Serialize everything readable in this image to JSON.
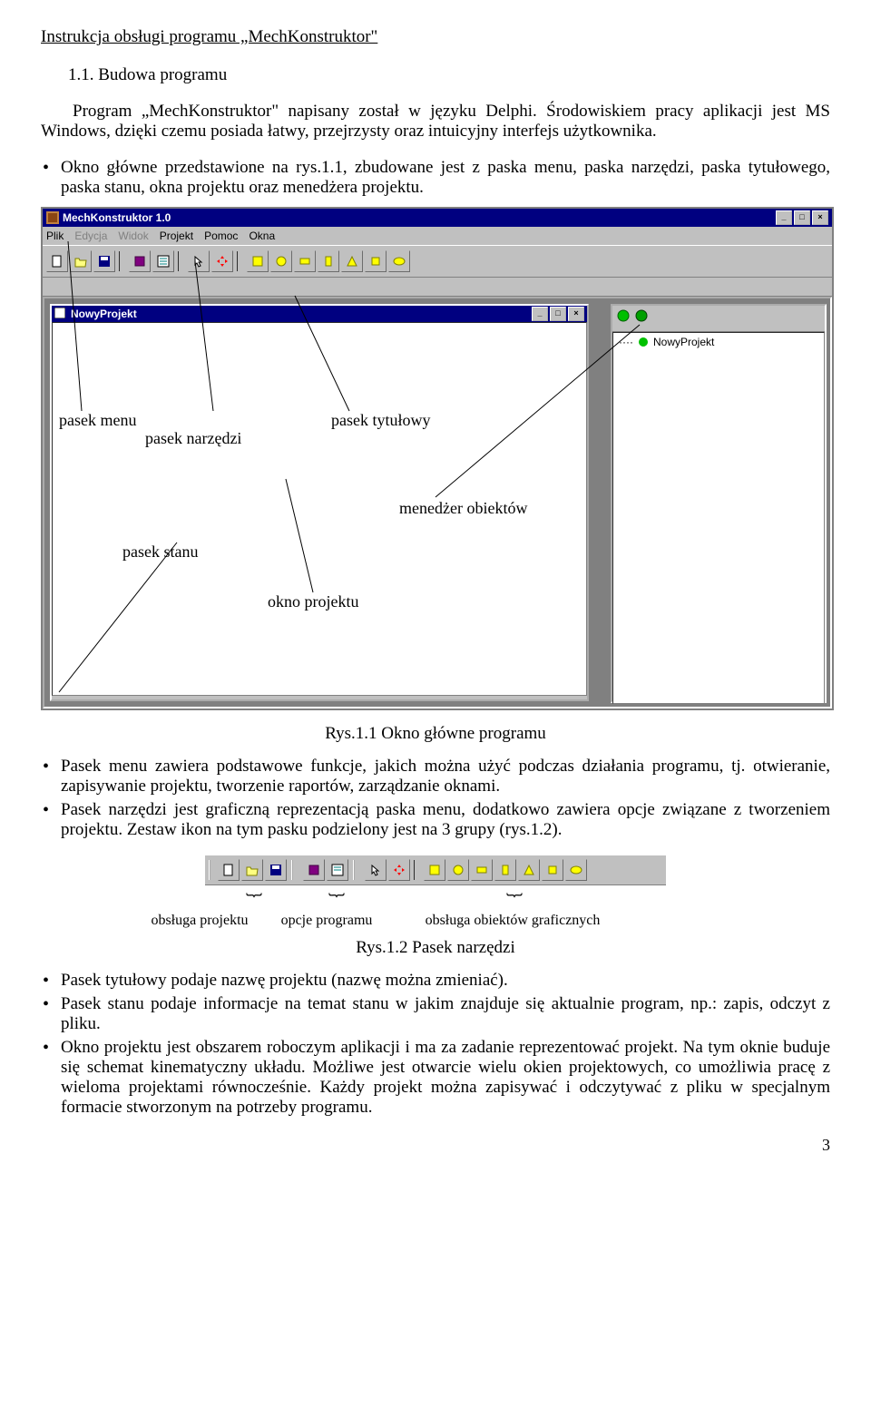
{
  "header": "Instrukcja obsługi programu „MechKonstruktor\"",
  "section": "1.1. Budowa programu",
  "intro_para": "Program „MechKonstruktor\" napisany został w języku Delphi. Środowiskiem pracy aplikacji jest MS Windows, dzięki czemu posiada łatwy, przejrzysty oraz intuicyjny interfejs użytkownika.",
  "bullet1": "Okno główne przedstawione na rys.1.1, zbudowane jest z paska menu, paska narzędzi, paska tytułowego, paska stanu, okna projektu oraz menedżera projektu.",
  "win": {
    "title": "MechKonstruktor 1.0",
    "menus": [
      "Plik",
      "Edycja",
      "Widok",
      "Projekt",
      "Pomoc",
      "Okna"
    ],
    "sub_title": "NowyProjekt",
    "tree_item": "NowyProjekt"
  },
  "anno": {
    "pasek_menu": "pasek menu",
    "pasek_narzedzi": "pasek narzędzi",
    "pasek_tytulowy": "pasek tytułowy",
    "menedzer": "menedżer obiektów",
    "pasek_stanu": "pasek stanu",
    "okno_projektu": "okno projektu"
  },
  "caption1": "Rys.1.1 Okno główne programu",
  "bullets2": [
    "Pasek menu zawiera podstawowe funkcje, jakich można użyć podczas działania programu, tj. otwieranie, zapisywanie projektu, tworzenie raportów, zarządzanie oknami.",
    "Pasek narzędzi jest graficzną reprezentacją paska menu, dodatkowo zawiera opcje związane z tworzeniem projektu. Zestaw ikon na tym pasku podzielony jest na 3 grupy (rys.1.2)."
  ],
  "brace_labels": {
    "a": "obsługa projektu",
    "b": "opcje programu",
    "c": "obsługa obiektów graficznych"
  },
  "caption2": "Rys.1.2 Pasek narzędzi",
  "bullets3": [
    "Pasek tytułowy podaje nazwę projektu (nazwę można zmieniać).",
    "Pasek stanu podaje informacje na temat stanu w jakim znajduje się aktualnie program, np.: zapis, odczyt z pliku.",
    "Okno projektu jest obszarem roboczym aplikacji i ma za zadanie reprezentować projekt. Na tym oknie buduje się schemat kinematyczny układu. Możliwe jest otwarcie wielu okien projektowych, co umożliwia pracę z wieloma projektami równocześnie. Każdy projekt można zapisywać i odczytywać z pliku w specjalnym formacie stworzonym na potrzeby programu."
  ],
  "pagenum": "3"
}
